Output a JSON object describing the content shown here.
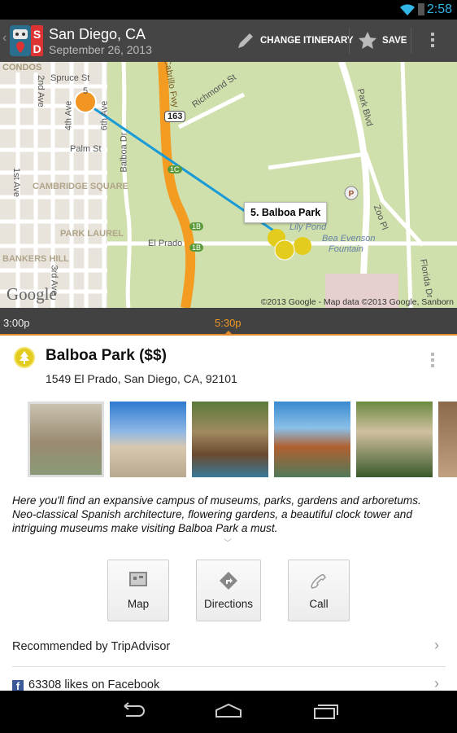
{
  "status_bar": {
    "time": "2:58"
  },
  "action_bar": {
    "title": "San Diego, CA",
    "date": "September 26, 2013",
    "change_itinerary": "CHANGE ITINERARY",
    "save": "SAVE",
    "logo_text": "SD"
  },
  "map": {
    "labels": [
      "Spruce St",
      "2nd Ave",
      "4th Ave",
      "5",
      "6th Ave",
      "Palm St",
      "1st Ave",
      "Balboa Dr",
      "Cabrillo Fwy",
      "Richmond St",
      "163",
      "1C",
      "1B",
      "1B",
      "El Prado",
      "Park Blvd",
      "Zoo Pl",
      "Florida Dr",
      "Lily Pond",
      "Bea Evenson",
      "Fountain",
      "3rd Ave",
      "CONDOS"
    ],
    "areas": [
      "CAMBRIDGE SQUARE",
      "PARK LAUREL",
      "BANKERS HILL"
    ],
    "callout": "5. Balboa Park",
    "copyright": "©2013 Google - Map data ©2013 Google, Sanborn",
    "google_logo": "Google",
    "route_color": "#1a9ad6",
    "freeway_color": "#f39c21"
  },
  "timeline": {
    "times": [
      "3:00p",
      "5:30p"
    ],
    "current": "5:30p",
    "accent": "#f39522"
  },
  "place": {
    "name": "Balboa Park ($$)",
    "address": "1549 El Prado, San Diego, CA, 92101",
    "icon": "tree-icon",
    "description": "Here you'll find an expansive campus of museums, parks, gardens and arboretums. Neo-classical Spanish architecture, flowering gardens, a beautiful clock tower and intriguing museums make visiting Balboa Park a must.",
    "photo_count_visible": 6
  },
  "actions": [
    {
      "label": "Map",
      "icon": "map-icon"
    },
    {
      "label": "Directions",
      "icon": "directions-icon"
    },
    {
      "label": "Call",
      "icon": "phone-icon"
    }
  ],
  "rows": [
    {
      "label": "Recommended by TripAdvisor"
    },
    {
      "label": "63308 likes on Facebook",
      "icon": "facebook-icon"
    }
  ]
}
